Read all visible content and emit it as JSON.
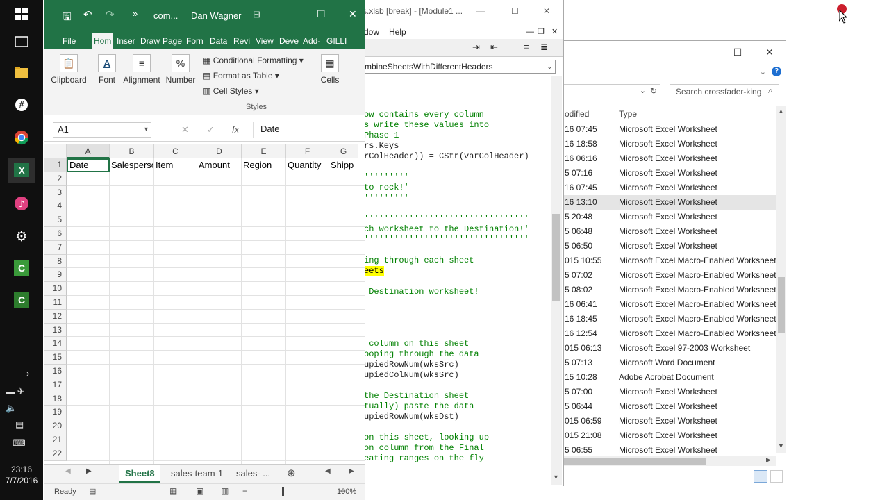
{
  "taskbar": {
    "icons": [
      "windows-icon",
      "task-view-icon",
      "file-explorer-icon",
      "slack-icon",
      "chrome-icon",
      "excel-icon",
      "itunes-icon",
      "settings-icon",
      "camtasia-icon",
      "camtasia-recorder-icon"
    ],
    "clock_time": "23:16",
    "clock_date": "7/7/2016"
  },
  "excel": {
    "title": "com...",
    "user": "Dan Wagner",
    "tabs": [
      "File",
      "Hom",
      "Inser",
      "Draw",
      "Page",
      "Forn",
      "Data",
      "Revi",
      "View",
      "Deve",
      "Add-",
      "GILLI"
    ],
    "active_tab": "Hom",
    "ribbon": {
      "clipboard": "Clipboard",
      "font": "Font",
      "alignment": "Alignment",
      "number": "Number",
      "conditional_formatting": "Conditional Formatting",
      "format_as_table": "Format as Table",
      "cell_styles": "Cell Styles",
      "styles_group": "Styles",
      "cells": "Cells"
    },
    "name_box": "A1",
    "formula_value": "Date",
    "fx": "fx",
    "columns": [
      "A",
      "B",
      "C",
      "D",
      "E",
      "F",
      "G"
    ],
    "rows": [
      "1",
      "2",
      "3",
      "4",
      "5",
      "6",
      "7",
      "8",
      "9",
      "10",
      "11",
      "12",
      "13",
      "14",
      "15",
      "16",
      "17",
      "18",
      "19",
      "20",
      "21",
      "22"
    ],
    "header_row": [
      "Date",
      "Salesperson",
      "Item",
      "Amount",
      "Region",
      "Quantity",
      "Shipp"
    ],
    "sheets": [
      "Sheet8",
      "sales-team-1",
      "sales- ..."
    ],
    "active_sheet": "Sheet8",
    "status_ready": "Ready",
    "zoom": "100%"
  },
  "vbe": {
    "title": "rs.xlsb [break] - [Module1 ...",
    "menu_window": "dow",
    "menu_help": "Help",
    "procedure": "mbineSheetsWithDifferentHeaders",
    "code_lines": [
      {
        "t": "ow contains every column",
        "c": "cm"
      },
      {
        "t": "s write these values into",
        "c": "cm"
      },
      {
        "t": "Phase 1",
        "c": "cm"
      },
      {
        "t": "rs.Keys",
        "c": ""
      },
      {
        "t": "rColHeader)) = CStr(varColHeader)",
        "c": ""
      },
      {
        "t": "",
        "c": ""
      },
      {
        "t": "'''''''''",
        "c": "cm"
      },
      {
        "t": "to rock!'",
        "c": "cm"
      },
      {
        "t": "'''''''''",
        "c": "cm"
      },
      {
        "t": "",
        "c": ""
      },
      {
        "t": "'''''''''''''''''''''''''''''''''",
        "c": "cm"
      },
      {
        "t": "ch worksheet to the Destination!'",
        "c": "cm"
      },
      {
        "t": "'''''''''''''''''''''''''''''''''",
        "c": "cm"
      },
      {
        "t": "",
        "c": ""
      },
      {
        "t": "ing through each sheet",
        "c": "cm"
      },
      {
        "t": "eets",
        "c": "hl"
      },
      {
        "t": "",
        "c": ""
      },
      {
        "t": " Destination worksheet!",
        "c": "cm"
      },
      {
        "t": "",
        "c": ""
      },
      {
        "t": "",
        "c": ""
      },
      {
        "t": "",
        "c": ""
      },
      {
        "t": "",
        "c": ""
      },
      {
        "t": " column on this sheet",
        "c": "cm"
      },
      {
        "t": "ooping through the data",
        "c": "cm"
      },
      {
        "t": "upiedRowNum(wksSrc)",
        "c": ""
      },
      {
        "t": "upiedColNum(wksSrc)",
        "c": ""
      },
      {
        "t": "",
        "c": ""
      },
      {
        "t": "the Destination sheet",
        "c": "cm"
      },
      {
        "t": "tually) paste the data",
        "c": "cm"
      },
      {
        "t": "upiedRowNum(wksDst)",
        "c": ""
      },
      {
        "t": "",
        "c": ""
      },
      {
        "t": "on this sheet, looking up",
        "c": "cm"
      },
      {
        "t": "on column from the Final",
        "c": "cm"
      },
      {
        "t": "eating ranges on the fly",
        "c": "cm"
      }
    ]
  },
  "explorer": {
    "search_placeholder": "Search crossfader-king",
    "col_modified": "odified",
    "col_type": "Type",
    "rows": [
      {
        "m": "16 07:45",
        "t": "Microsoft Excel Worksheet"
      },
      {
        "m": "16 18:58",
        "t": "Microsoft Excel Worksheet"
      },
      {
        "m": "16 06:16",
        "t": "Microsoft Excel Worksheet"
      },
      {
        "m": "5 07:16",
        "t": "Microsoft Excel Worksheet"
      },
      {
        "m": "16 07:45",
        "t": "Microsoft Excel Worksheet"
      },
      {
        "m": "16 13:10",
        "t": "Microsoft Excel Worksheet",
        "sel": true
      },
      {
        "m": "5 20:48",
        "t": "Microsoft Excel Worksheet"
      },
      {
        "m": "5 06:48",
        "t": "Microsoft Excel Worksheet"
      },
      {
        "m": "5 06:50",
        "t": "Microsoft Excel Worksheet"
      },
      {
        "m": "015 10:55",
        "t": "Microsoft Excel Macro-Enabled Worksheet"
      },
      {
        "m": "5 07:02",
        "t": "Microsoft Excel Macro-Enabled Worksheet"
      },
      {
        "m": "5 08:02",
        "t": "Microsoft Excel Macro-Enabled Worksheet"
      },
      {
        "m": "16 06:41",
        "t": "Microsoft Excel Macro-Enabled Worksheet"
      },
      {
        "m": "16 18:45",
        "t": "Microsoft Excel Macro-Enabled Worksheet"
      },
      {
        "m": "16 12:54",
        "t": "Microsoft Excel Macro-Enabled Worksheet"
      },
      {
        "m": "015 06:13",
        "t": "Microsoft Excel 97-2003 Worksheet"
      },
      {
        "m": "5 07:13",
        "t": "Microsoft Word Document"
      },
      {
        "m": "15 10:28",
        "t": "Adobe Acrobat Document"
      },
      {
        "m": "5 07:00",
        "t": "Microsoft Excel Worksheet"
      },
      {
        "m": "5 06:44",
        "t": "Microsoft Excel Worksheet"
      },
      {
        "m": "015 06:59",
        "t": "Microsoft Excel Worksheet"
      },
      {
        "m": "015 21:08",
        "t": "Microsoft Excel Worksheet"
      },
      {
        "m": "5 06:55",
        "t": "Microsoft Excel Worksheet"
      }
    ]
  },
  "colors": {
    "excel_green": "#217346",
    "code_comment": "#008000",
    "highlight": "#ffff00"
  }
}
